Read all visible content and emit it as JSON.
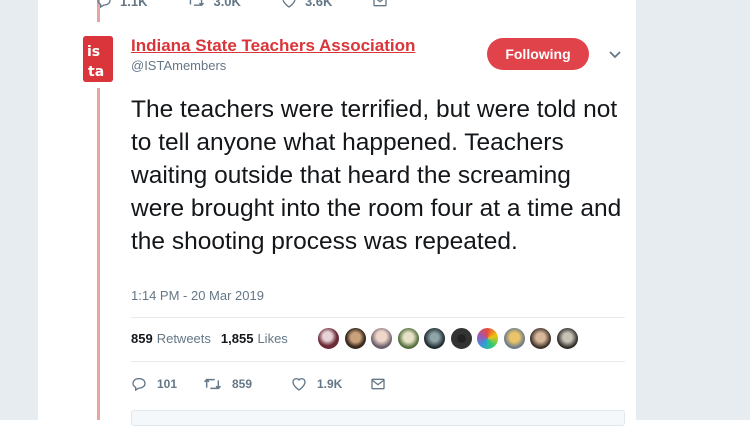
{
  "previous_tweet": {
    "reply_count": "1.1K",
    "retweet_count": "3.0K",
    "like_count": "3.6K"
  },
  "tweet": {
    "author_name": "Indiana State Teachers Association",
    "author_handle": "@ISTAmembers",
    "avatar_logo_text": "ISTA",
    "follow_label": "Following",
    "text": "The teachers were terrified, but were told not to tell anyone what happened. Teachers waiting outside that heard the screaming were brought into the room four at a time and the shooting process was repeated.",
    "timestamp": "1:14 PM - 20 Mar 2019",
    "retweets_value": "859",
    "retweets_label": "Retweets",
    "likes_value": "1,855",
    "likes_label": "Likes",
    "liker_avatar_count": 10,
    "reply_count": "101",
    "retweet_count": "859",
    "like_count": "1.9K"
  },
  "colors": {
    "accent": "#e0434a",
    "brand_red": "#d9353a",
    "thread_line": "#e8a3a3",
    "muted": "#657786",
    "text": "#14171a",
    "background": "#e6ecf0"
  },
  "icons": [
    "reply-icon",
    "retweet-icon",
    "heart-icon",
    "message-icon",
    "chevron-down-icon"
  ]
}
